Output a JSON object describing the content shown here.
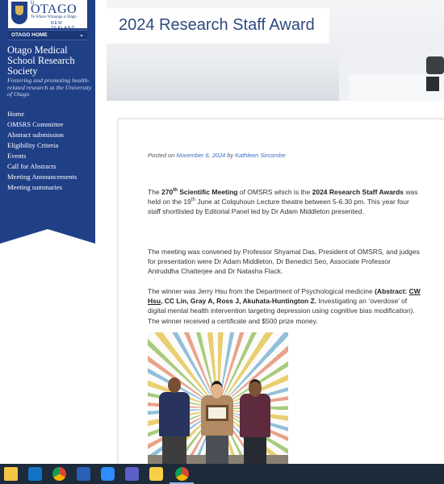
{
  "page": {
    "title": "2024 Research Staff Award"
  },
  "sidebar": {
    "logo": {
      "university": "OTAGO",
      "prefix": "U",
      "tagline": "Te Whare Wānanga o Otāgo",
      "country": "NEW ZEALAND"
    },
    "otago_home": "OTAGO HOME",
    "site_title": "Otago Medical School Research Society",
    "site_subtitle": "Fostering and promoting health-related research at the University of Otago",
    "nav": [
      {
        "label": "Home"
      },
      {
        "label": "OMSRS Committee"
      },
      {
        "label": "Abstract submission"
      },
      {
        "label": "Eligibility Criteria"
      },
      {
        "label": "Events"
      },
      {
        "label": "Call for Abstracts"
      },
      {
        "label": "Meeting Announcements"
      },
      {
        "label": "Meeting summaries"
      }
    ]
  },
  "post": {
    "posted_on": "Posted on",
    "date": "November 6, 2024",
    "by": "by",
    "author": "Kathleen Sircombe",
    "p1": {
      "a": "The ",
      "num": "270",
      "num_sup": "th",
      "b": " Scientific Meeting",
      "c": " of OMSRS which is the ",
      "d": "2024 Research Staff Awards",
      "e": " was held on the 19",
      "e_sup": "th",
      "f": " June at Colquhoun Lecture theatre between 5-6.30 pm. This year four staff shortlisted by Editorial Panel led by Dr Adam Middleton presented."
    },
    "p2": "The meeting was convened by Professor Shyamal Das, President of OMSRS, and judges for presentation were Dr Adam Middleton, Dr Benedict Seo, Associate Professor Aniruddha Chatterjee and Dr Natasha Flack.",
    "p3": {
      "a": "The winner was Jerry Hsu from the Department of Psychological medicine ",
      "b": "(Abstract: ",
      "c": "CW Hsu",
      "d": ", CC Lin, Gray A, Ross J, Akuhata-Huntington Z.",
      "e": " Investigating an ‘overdose’ of digital mental health intervention targeting depression using  cognitive bias modification). The winner received a certificate and $500 prize money."
    }
  },
  "taskbar": {
    "icons": [
      "file-explorer",
      "outlook",
      "chrome",
      "word",
      "zoom",
      "teams",
      "sticky-notes",
      "chrome"
    ],
    "colors": {
      "background": "#1c2a3a",
      "accent": "#8fb6e8"
    }
  },
  "colors": {
    "sidebar": "#1f3f86",
    "title_text": "#2e4a80",
    "link": "#3a6cc2"
  }
}
